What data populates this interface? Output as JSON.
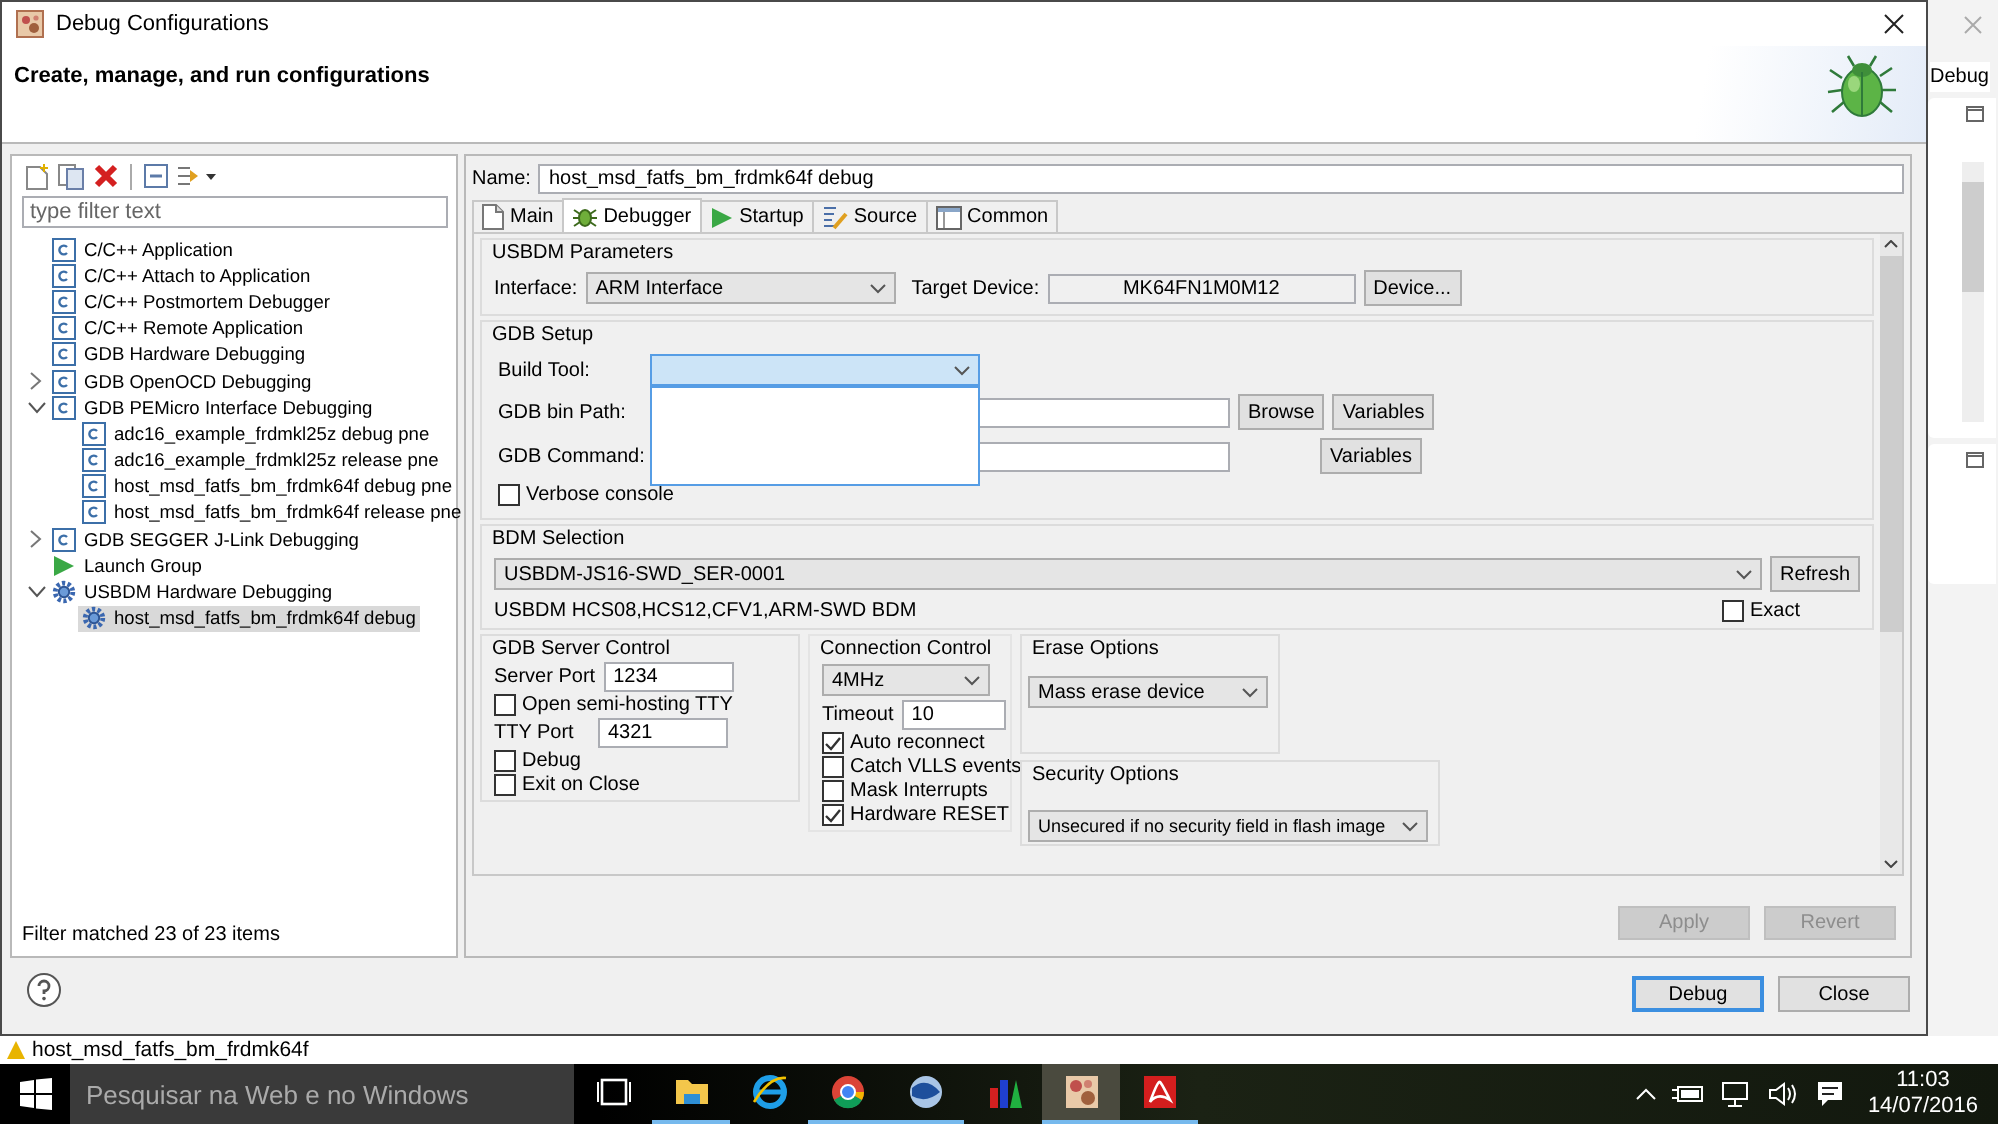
{
  "window": {
    "title": "Debug Configurations",
    "header": "Create, manage, and run configurations"
  },
  "sidebar": {
    "filter": {
      "placeholder": "type filter text"
    },
    "tree": [
      {
        "label": "C/C++ Application",
        "kind": "c-type",
        "selected": false
      },
      {
        "label": "C/C++ Attach to Application",
        "kind": "c-type",
        "selected": false
      },
      {
        "label": "C/C++ Postmortem Debugger",
        "kind": "c-type",
        "selected": false
      },
      {
        "label": "C/C++ Remote Application",
        "kind": "c-type",
        "selected": false
      },
      {
        "label": "GDB Hardware Debugging",
        "kind": "c-type",
        "selected": false
      },
      {
        "label": "GDB OpenOCD Debugging",
        "kind": "c-folder",
        "expanded": false,
        "selected": false
      },
      {
        "label": "GDB PEMicro Interface Debugging",
        "kind": "c-folder",
        "expanded": true,
        "selected": false,
        "children": [
          {
            "label": "adc16_example_frdmkl25z debug pne",
            "kind": "c-type",
            "selected": false
          },
          {
            "label": "adc16_example_frdmkl25z release pne",
            "kind": "c-type",
            "selected": false
          },
          {
            "label": "host_msd_fatfs_bm_frdmk64f debug pne",
            "kind": "c-type",
            "selected": false
          },
          {
            "label": "host_msd_fatfs_bm_frdmk64f release pne",
            "kind": "c-type",
            "selected": false
          }
        ]
      },
      {
        "label": "GDB SEGGER J-Link Debugging",
        "kind": "c-folder",
        "expanded": false,
        "selected": false
      },
      {
        "label": "Launch Group",
        "kind": "launch",
        "selected": false
      },
      {
        "label": "USBDM Hardware Debugging",
        "kind": "gear-folder",
        "expanded": true,
        "selected": false,
        "children": [
          {
            "label": "host_msd_fatfs_bm_frdmk64f debug",
            "kind": "gear",
            "selected": true
          }
        ]
      }
    ],
    "status": "Filter matched 23 of 23 items"
  },
  "config": {
    "name_label": "Name:",
    "name_value": "host_msd_fatfs_bm_frdmk64f debug",
    "tabs": [
      {
        "label": "Main",
        "kind": "page",
        "selected": false
      },
      {
        "label": "Debugger",
        "kind": "bug",
        "selected": true
      },
      {
        "label": "Startup",
        "kind": "play",
        "selected": false
      },
      {
        "label": "Source",
        "kind": "source",
        "selected": false
      },
      {
        "label": "Common",
        "kind": "window",
        "selected": false
      }
    ],
    "usbdm_parameters": {
      "title": "USBDM Parameters",
      "interface_label": "Interface:",
      "interface_value": "ARM Interface",
      "target_label": "Target Device:",
      "target_value": "MK64FN1M0M12",
      "device_button": "Device..."
    },
    "gdb_setup": {
      "title": "GDB Setup",
      "build_tool_label": "Build Tool:",
      "build_tool_expanded": true,
      "bin_path_label": "GDB bin Path:",
      "browse_button": "Browse",
      "bin_path_variables_button": "Variables",
      "command_label": "GDB Command:",
      "command_variables_button": "Variables",
      "verbose": {
        "label": "Verbose console",
        "checked": false
      }
    },
    "bdm_selection": {
      "title": "BDM Selection",
      "device": "USBDM-JS16-SWD_SER-0001",
      "refresh_button": "Refresh",
      "description": "USBDM HCS08,HCS12,CFV1,ARM-SWD BDM",
      "exact": {
        "label": "Exact",
        "checked": false
      }
    },
    "gdb_server_control": {
      "title": "GDB Server Control",
      "server_port_label": "Server Port",
      "server_port": "1234",
      "semihosting": {
        "label": "Open semi-hosting TTY",
        "checked": false
      },
      "tty_port_label": "TTY Port",
      "tty_port": "4321",
      "options": [
        {
          "label": "Debug",
          "checked": false
        },
        {
          "label": "Exit on Close",
          "checked": false
        }
      ]
    },
    "connection_control": {
      "title": "Connection Control",
      "speed": "4MHz",
      "timeout_label": "Timeout",
      "timeout": "10",
      "options": [
        {
          "label": "Auto reconnect",
          "checked": true
        },
        {
          "label": "Catch VLLS events",
          "checked": false
        },
        {
          "label": "Mask Interrupts",
          "checked": false
        },
        {
          "label": "Hardware RESET",
          "checked": true
        }
      ]
    },
    "erase_options": {
      "title": "Erase Options",
      "value": "Mass erase device"
    },
    "security_options": {
      "title": "Security Options",
      "value": "Unsecured if no security field in flash image"
    },
    "apply_button": {
      "label": "Apply",
      "disabled": true
    },
    "revert_button": {
      "label": "Revert",
      "disabled": true
    }
  },
  "dialog_buttons": [
    {
      "label": "Debug",
      "default": true
    },
    {
      "label": "Close",
      "default": false
    }
  ],
  "background_window": {
    "perspective": "Debug",
    "console_line": "host_msd_fatfs_bm_frdmk64f"
  },
  "taskbar": {
    "search": {
      "placeholder": "Pesquisar na Web e no Windows"
    },
    "apps": [
      {
        "kind": "taskview",
        "running": false,
        "selected": false
      },
      {
        "kind": "folder",
        "running": true,
        "selected": false
      },
      {
        "kind": "ie",
        "running": false,
        "selected": false
      },
      {
        "kind": "chrome",
        "running": true,
        "selected": false
      },
      {
        "kind": "mail",
        "running": true,
        "selected": false
      },
      {
        "kind": "bars",
        "running": false,
        "selected": false
      },
      {
        "kind": "eclipse",
        "running": true,
        "selected": true
      },
      {
        "kind": "pdf",
        "running": true,
        "selected": false
      }
    ],
    "time": "11:03",
    "date": "14/07/2016"
  }
}
